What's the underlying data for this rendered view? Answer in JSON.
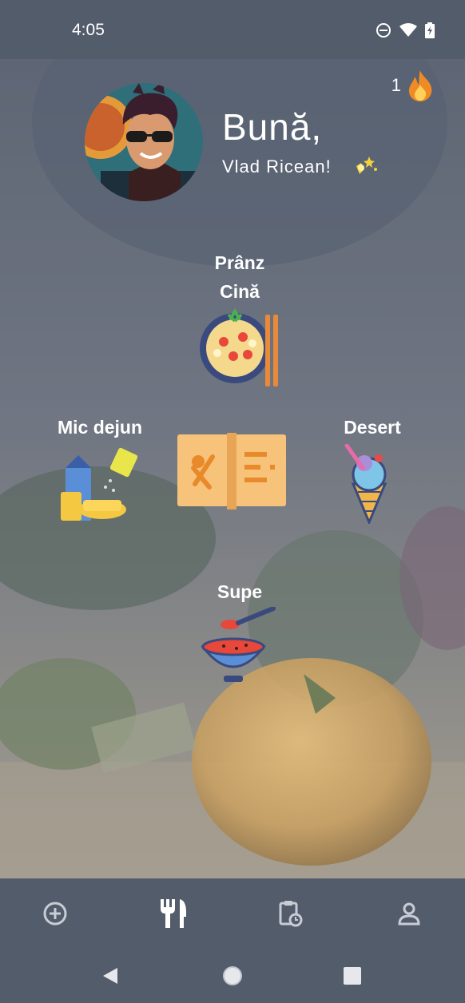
{
  "status": {
    "time": "4:05"
  },
  "streak": {
    "count": "1",
    "icon": "fire-icon"
  },
  "greeting": {
    "title": "Bună,",
    "name": "Vlad Ricean!"
  },
  "categories": {
    "lunch_dinner": {
      "line1": "Prânz",
      "line2": "Cină"
    },
    "breakfast": {
      "label": "Mic dejun"
    },
    "dessert": {
      "label": "Desert"
    },
    "soups": {
      "label": "Supe"
    }
  },
  "colors": {
    "bar": "#535c6b",
    "accent_orange": "#f5a33f",
    "menu_book": "#f7c27a"
  },
  "bottom_nav": {
    "items": [
      {
        "name": "add",
        "icon": "plus-circle-icon"
      },
      {
        "name": "recipes",
        "icon": "fork-knife-icon",
        "active": true
      },
      {
        "name": "schedule",
        "icon": "clipboard-clock-icon"
      },
      {
        "name": "profile",
        "icon": "person-icon"
      }
    ]
  }
}
